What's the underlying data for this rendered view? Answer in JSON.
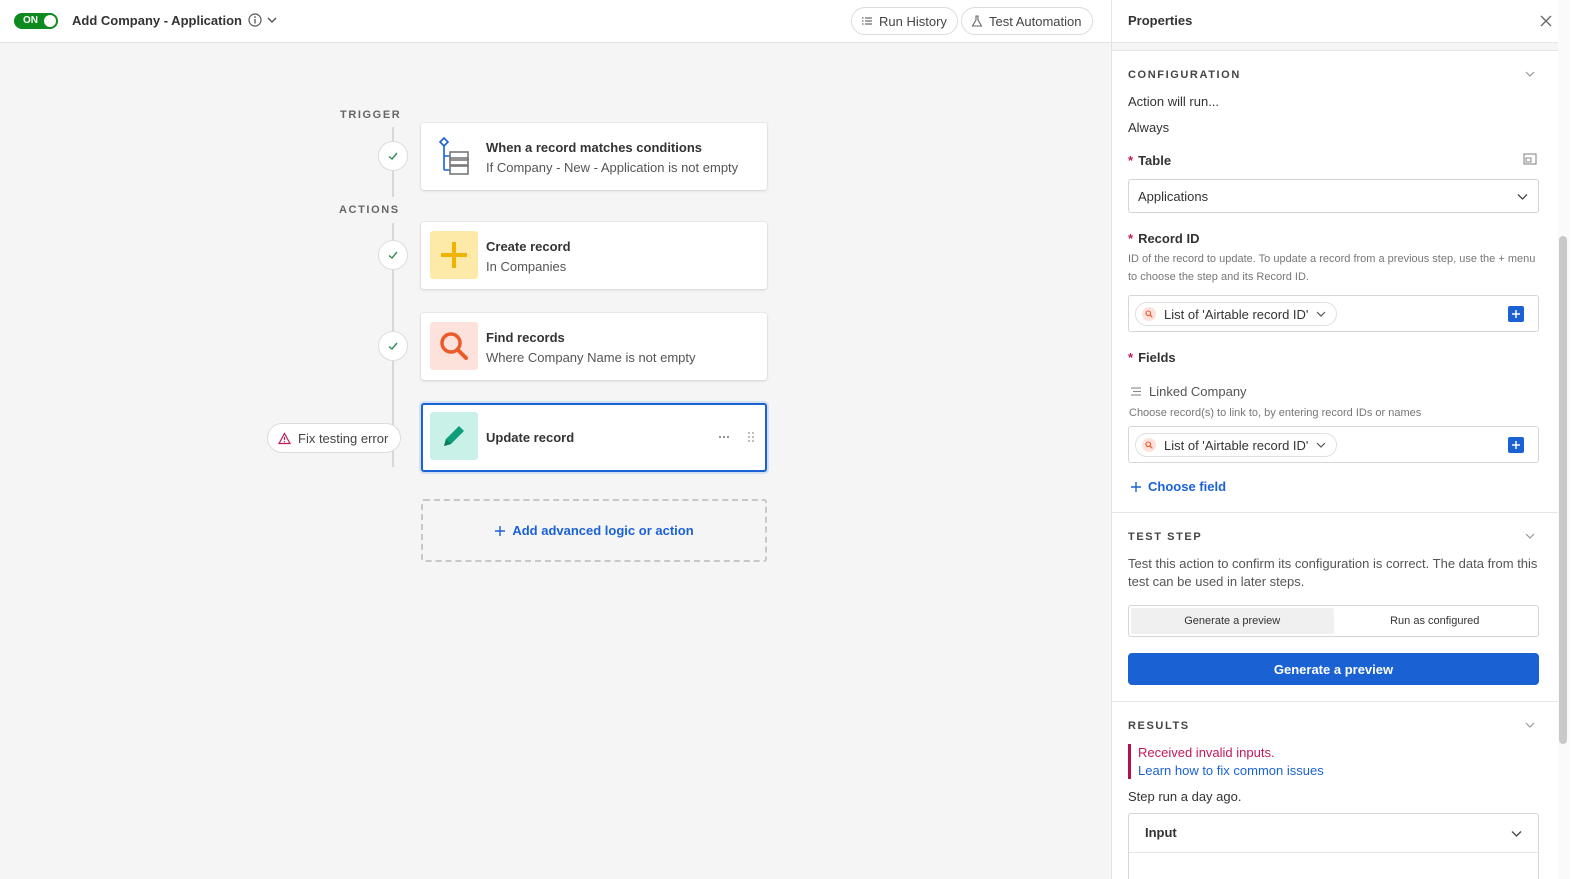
{
  "header": {
    "toggle_label": "ON",
    "title": "Add Company - Application",
    "run_history": "Run History",
    "test_automation": "Test Automation"
  },
  "canvas": {
    "trigger_label": "TRIGGER",
    "actions_label": "ACTIONS",
    "trigger_card": {
      "title": "When a record matches conditions",
      "subtitle": "If Company - New - Application is not empty"
    },
    "create_card": {
      "title": "Create record",
      "subtitle": "In Companies"
    },
    "find_card": {
      "title": "Find records",
      "subtitle": "Where Company Name is not empty"
    },
    "update_card": {
      "title": "Update record"
    },
    "fix_error": "Fix testing error",
    "add_action": "Add advanced logic or action"
  },
  "panel": {
    "title": "Properties",
    "configuration": {
      "heading": "CONFIGURATION",
      "run_label": "Action will run...",
      "run_value": "Always",
      "table_label": "Table",
      "table_value": "Applications",
      "record_id_label": "Record ID",
      "record_id_help": "ID of the record to update. To update a record from a previous step, use the + menu to choose the step and its Record ID.",
      "record_id_token": "List of 'Airtable record ID'",
      "fields_label": "Fields",
      "linked_company_label": "Linked Company",
      "linked_company_help": "Choose record(s) to link to, by entering record IDs or names",
      "linked_company_token": "List of 'Airtable record ID'",
      "choose_field": "Choose field"
    },
    "test_step": {
      "heading": "TEST STEP",
      "description": "Test this action to confirm its configuration is correct. The data from this test can be used in later steps.",
      "tab_preview": "Generate a preview",
      "tab_run": "Run as configured",
      "button": "Generate a preview"
    },
    "results": {
      "heading": "RESULTS",
      "error": "Received invalid inputs.",
      "help_link": "Learn how to fix common issues",
      "last_run": "Step run a day ago.",
      "input_label": "Input"
    }
  },
  "colors": {
    "accent": "#1a62d4",
    "toggle_on": "#0f8a1e",
    "error": "#c2185b",
    "create_tile": "#fde9a8",
    "find_tile": "#fde2dc",
    "update_tile": "#c9f1e7"
  }
}
